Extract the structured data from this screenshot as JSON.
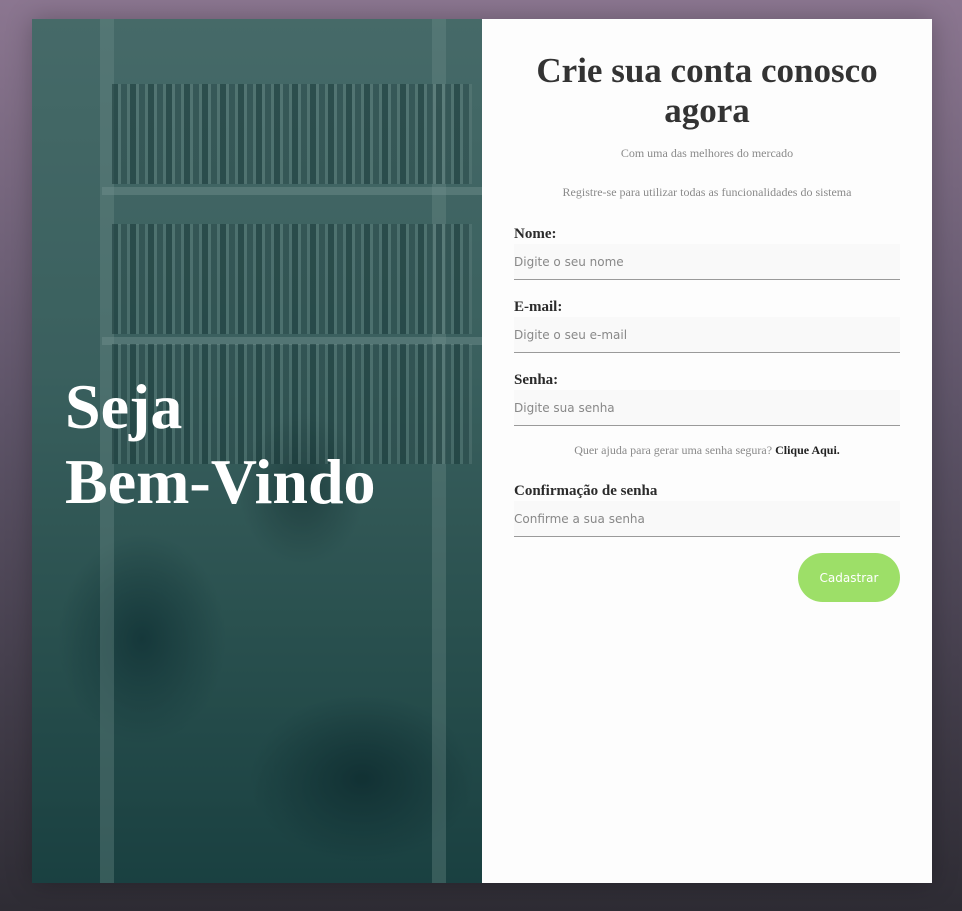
{
  "hero": {
    "title_line1": "Seja",
    "title_line2": "Bem-Vindo"
  },
  "form": {
    "title": "Crie sua conta conosco agora",
    "subtitle": "Com uma das melhores do mercado",
    "description": "Registre-se para utilizar todas as funcionalidades do sistema",
    "name": {
      "label": "Nome:",
      "placeholder": "Digite o seu nome",
      "value": ""
    },
    "email": {
      "label": "E-mail:",
      "placeholder": "Digite o seu e-mail",
      "value": ""
    },
    "password": {
      "label": "Senha:",
      "placeholder": "Digite sua senha",
      "value": ""
    },
    "password_help": {
      "text": "Quer ajuda para gerar uma senha segura?",
      "link": "Clique Aqui."
    },
    "confirm": {
      "label": "Confirmação de senha",
      "placeholder": "Confirme a sua senha",
      "value": ""
    },
    "submit_label": "Cadastrar"
  },
  "colors": {
    "accent": "#9ddf68",
    "overlay": "#1f4a4a",
    "text_dark": "#2b2b2b",
    "text_muted": "#8a8a8a"
  }
}
